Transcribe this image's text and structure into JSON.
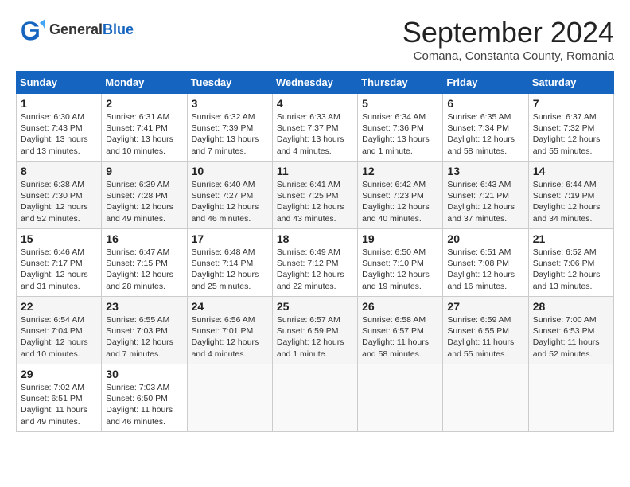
{
  "header": {
    "logo_line1": "General",
    "logo_line2": "Blue",
    "month_title": "September 2024",
    "subtitle": "Comana, Constanta County, Romania"
  },
  "days_of_week": [
    "Sunday",
    "Monday",
    "Tuesday",
    "Wednesday",
    "Thursday",
    "Friday",
    "Saturday"
  ],
  "weeks": [
    [
      {
        "day": "1",
        "info": "Sunrise: 6:30 AM\nSunset: 7:43 PM\nDaylight: 13 hours\nand 13 minutes."
      },
      {
        "day": "2",
        "info": "Sunrise: 6:31 AM\nSunset: 7:41 PM\nDaylight: 13 hours\nand 10 minutes."
      },
      {
        "day": "3",
        "info": "Sunrise: 6:32 AM\nSunset: 7:39 PM\nDaylight: 13 hours\nand 7 minutes."
      },
      {
        "day": "4",
        "info": "Sunrise: 6:33 AM\nSunset: 7:37 PM\nDaylight: 13 hours\nand 4 minutes."
      },
      {
        "day": "5",
        "info": "Sunrise: 6:34 AM\nSunset: 7:36 PM\nDaylight: 13 hours\nand 1 minute."
      },
      {
        "day": "6",
        "info": "Sunrise: 6:35 AM\nSunset: 7:34 PM\nDaylight: 12 hours\nand 58 minutes."
      },
      {
        "day": "7",
        "info": "Sunrise: 6:37 AM\nSunset: 7:32 PM\nDaylight: 12 hours\nand 55 minutes."
      }
    ],
    [
      {
        "day": "8",
        "info": "Sunrise: 6:38 AM\nSunset: 7:30 PM\nDaylight: 12 hours\nand 52 minutes."
      },
      {
        "day": "9",
        "info": "Sunrise: 6:39 AM\nSunset: 7:28 PM\nDaylight: 12 hours\nand 49 minutes."
      },
      {
        "day": "10",
        "info": "Sunrise: 6:40 AM\nSunset: 7:27 PM\nDaylight: 12 hours\nand 46 minutes."
      },
      {
        "day": "11",
        "info": "Sunrise: 6:41 AM\nSunset: 7:25 PM\nDaylight: 12 hours\nand 43 minutes."
      },
      {
        "day": "12",
        "info": "Sunrise: 6:42 AM\nSunset: 7:23 PM\nDaylight: 12 hours\nand 40 minutes."
      },
      {
        "day": "13",
        "info": "Sunrise: 6:43 AM\nSunset: 7:21 PM\nDaylight: 12 hours\nand 37 minutes."
      },
      {
        "day": "14",
        "info": "Sunrise: 6:44 AM\nSunset: 7:19 PM\nDaylight: 12 hours\nand 34 minutes."
      }
    ],
    [
      {
        "day": "15",
        "info": "Sunrise: 6:46 AM\nSunset: 7:17 PM\nDaylight: 12 hours\nand 31 minutes."
      },
      {
        "day": "16",
        "info": "Sunrise: 6:47 AM\nSunset: 7:15 PM\nDaylight: 12 hours\nand 28 minutes."
      },
      {
        "day": "17",
        "info": "Sunrise: 6:48 AM\nSunset: 7:14 PM\nDaylight: 12 hours\nand 25 minutes."
      },
      {
        "day": "18",
        "info": "Sunrise: 6:49 AM\nSunset: 7:12 PM\nDaylight: 12 hours\nand 22 minutes."
      },
      {
        "day": "19",
        "info": "Sunrise: 6:50 AM\nSunset: 7:10 PM\nDaylight: 12 hours\nand 19 minutes."
      },
      {
        "day": "20",
        "info": "Sunrise: 6:51 AM\nSunset: 7:08 PM\nDaylight: 12 hours\nand 16 minutes."
      },
      {
        "day": "21",
        "info": "Sunrise: 6:52 AM\nSunset: 7:06 PM\nDaylight: 12 hours\nand 13 minutes."
      }
    ],
    [
      {
        "day": "22",
        "info": "Sunrise: 6:54 AM\nSunset: 7:04 PM\nDaylight: 12 hours\nand 10 minutes."
      },
      {
        "day": "23",
        "info": "Sunrise: 6:55 AM\nSunset: 7:03 PM\nDaylight: 12 hours\nand 7 minutes."
      },
      {
        "day": "24",
        "info": "Sunrise: 6:56 AM\nSunset: 7:01 PM\nDaylight: 12 hours\nand 4 minutes."
      },
      {
        "day": "25",
        "info": "Sunrise: 6:57 AM\nSunset: 6:59 PM\nDaylight: 12 hours\nand 1 minute."
      },
      {
        "day": "26",
        "info": "Sunrise: 6:58 AM\nSunset: 6:57 PM\nDaylight: 11 hours\nand 58 minutes."
      },
      {
        "day": "27",
        "info": "Sunrise: 6:59 AM\nSunset: 6:55 PM\nDaylight: 11 hours\nand 55 minutes."
      },
      {
        "day": "28",
        "info": "Sunrise: 7:00 AM\nSunset: 6:53 PM\nDaylight: 11 hours\nand 52 minutes."
      }
    ],
    [
      {
        "day": "29",
        "info": "Sunrise: 7:02 AM\nSunset: 6:51 PM\nDaylight: 11 hours\nand 49 minutes."
      },
      {
        "day": "30",
        "info": "Sunrise: 7:03 AM\nSunset: 6:50 PM\nDaylight: 11 hours\nand 46 minutes."
      },
      {
        "day": "",
        "info": ""
      },
      {
        "day": "",
        "info": ""
      },
      {
        "day": "",
        "info": ""
      },
      {
        "day": "",
        "info": ""
      },
      {
        "day": "",
        "info": ""
      }
    ]
  ]
}
